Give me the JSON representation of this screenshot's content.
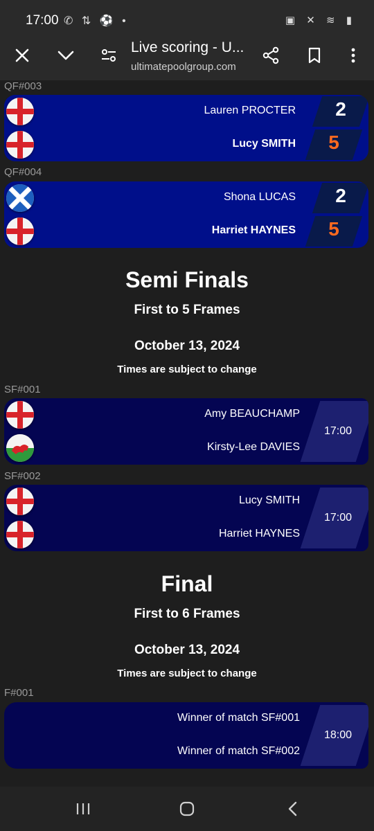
{
  "status": {
    "time": "17:00",
    "left_icons": "✆ ⇅ ⚽ •",
    "right_icons": "▣ ✕ ≋ ▮"
  },
  "browser": {
    "title": "Live scoring - U...",
    "url": "ultimatepoolgroup.com"
  },
  "quarter_finals": [
    {
      "label": "QF#003",
      "p1": {
        "name": "Lauren  PROCTER",
        "flag": "england",
        "score": "2",
        "winner": false
      },
      "p2": {
        "name": "Lucy  SMITH",
        "flag": "england",
        "score": "5",
        "winner": true
      }
    },
    {
      "label": "QF#004",
      "p1": {
        "name": "Shona  LUCAS",
        "flag": "scotland",
        "score": "2",
        "winner": false
      },
      "p2": {
        "name": "Harriet  HAYNES",
        "flag": "england",
        "score": "5",
        "winner": true
      }
    }
  ],
  "semi_finals": {
    "title": "Semi Finals",
    "subtitle": "First to 5 Frames",
    "date": "October 13, 2024",
    "note": "Times are subject to change",
    "matches": [
      {
        "label": "SF#001",
        "p1": {
          "name": "Amy  BEAUCHAMP",
          "flag": "england"
        },
        "p2": {
          "name": "Kirsty-Lee  DAVIES",
          "flag": "wales"
        },
        "time": "17:00"
      },
      {
        "label": "SF#002",
        "p1": {
          "name": "Lucy  SMITH",
          "flag": "england"
        },
        "p2": {
          "name": "Harriet  HAYNES",
          "flag": "england"
        },
        "time": "17:00"
      }
    ]
  },
  "final": {
    "title": "Final",
    "subtitle": "First to 6 Frames",
    "date": "October 13, 2024",
    "note": "Times are subject to change",
    "match": {
      "label": "F#001",
      "p1": {
        "name": "Winner of match SF#001"
      },
      "p2": {
        "name": "Winner of match SF#002"
      },
      "time": "18:00"
    }
  },
  "colors": {
    "qf_bg": "#000f8a",
    "sf_bg": "#040552",
    "win_score": "#ff6a1f",
    "page_bg": "#1e1e1e"
  }
}
